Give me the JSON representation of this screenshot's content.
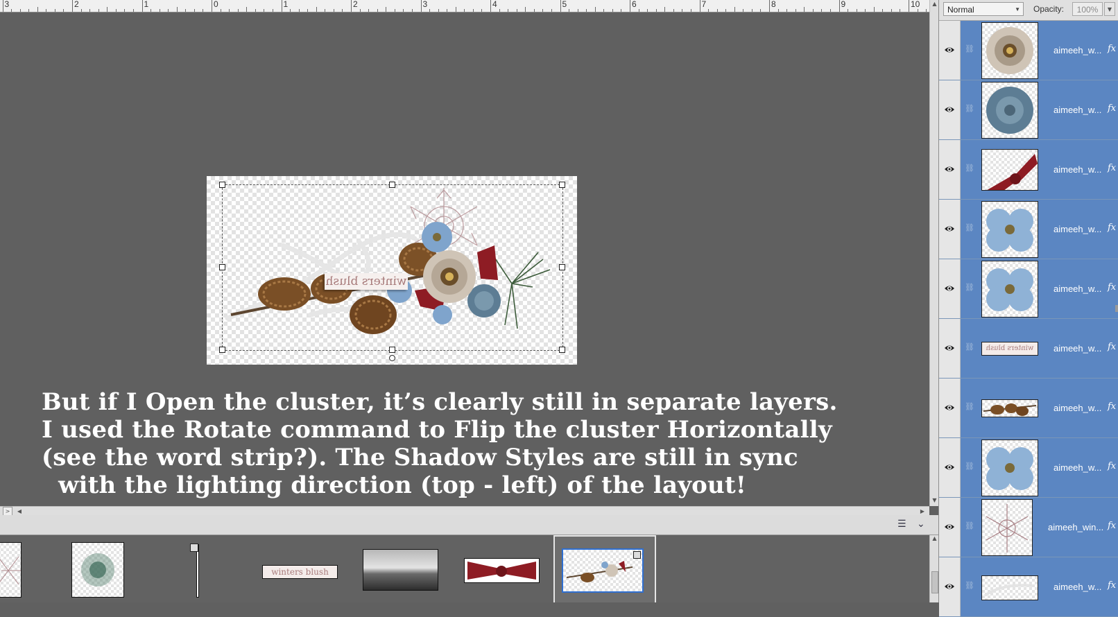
{
  "ruler": {
    "labels": [
      "3",
      "2",
      "1",
      "0",
      "1",
      "2",
      "3",
      "4",
      "5",
      "6",
      "7",
      "8",
      "9",
      "10"
    ]
  },
  "document": {
    "word_strip": "winters blush"
  },
  "caption": {
    "lines": [
      "But if I Open the cluster, it’s clearly still in separate layers.",
      "I used the Rotate command to Flip the cluster Horizontally",
      "(see the word strip?). The Shadow Styles are still in sync",
      "with the lighting direction (top - left) of the layout!"
    ]
  },
  "project_bin": {
    "word_strip_thumb": "winters blush"
  },
  "layers_panel": {
    "blend_mode": "Normal",
    "opacity_label": "Opacity:",
    "opacity_value": "100%",
    "fx_label": "fx",
    "layers": [
      {
        "name": "aimeeh_w...",
        "thumb": "cream-flower"
      },
      {
        "name": "aimeeh_w...",
        "thumb": "blue-mum"
      },
      {
        "name": "aimeeh_w...",
        "thumb": "red-bow"
      },
      {
        "name": "aimeeh_w...",
        "thumb": "blue-flower"
      },
      {
        "name": "aimeeh_w...",
        "thumb": "blue-flower"
      },
      {
        "name": "aimeeh_w...",
        "thumb": "word-strip",
        "thumb_text": "winters blush"
      },
      {
        "name": "aimeeh_w...",
        "thumb": "pinecones"
      },
      {
        "name": "aimeeh_w...",
        "thumb": "blue-flower"
      },
      {
        "name": "aimeeh_win...",
        "thumb": "snowflake"
      },
      {
        "name": "aimeeh_w...",
        "thumb": "white-twig"
      }
    ]
  },
  "colors": {
    "canvas_bg": "#606060",
    "layer_selected": "#5b86c2",
    "caption_text": "#ffffff"
  }
}
